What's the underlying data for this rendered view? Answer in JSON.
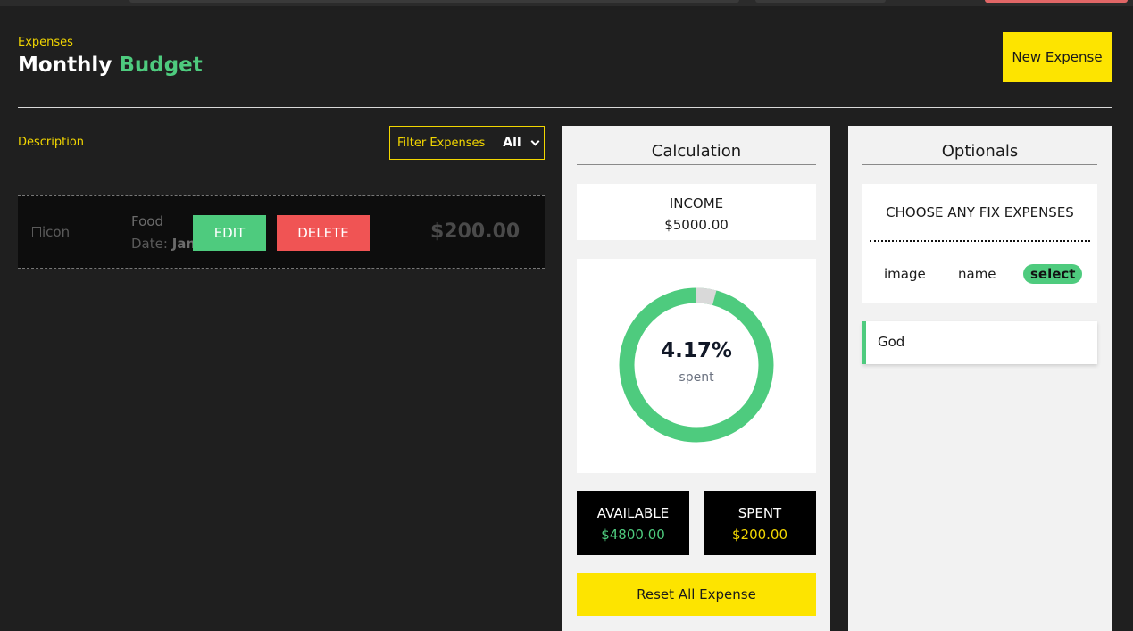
{
  "header": {
    "eyebrow": "Expenses",
    "title_main": "Monthly",
    "title_accent": "Budget",
    "new_expense_label": "New Expense"
  },
  "list": {
    "description_label": "Description",
    "filter_label": "Filter Expenses",
    "filter_value": "All",
    "items": [
      {
        "image_alt": "icon",
        "name": "Food",
        "date_prefix": "Date:",
        "date_value": "Jan 29",
        "edit_label": "EDIT",
        "delete_label": "DELETE",
        "amount": "$200.00"
      }
    ]
  },
  "calculation": {
    "title": "Calculation",
    "income_label": "INCOME",
    "income_value": "$5000.00",
    "spent_percent": "4.17%",
    "spent_fraction": 0.0417,
    "spent_sub": "spent",
    "available_label": "AVAILABLE",
    "available_value": "$4800.00",
    "spent_label": "SPENT",
    "spent_value": "$200.00",
    "reset_label": "Reset All Expense"
  },
  "optionals": {
    "title": "Optionals",
    "choose_title": "CHOOSE ANY FIX EXPENSES",
    "col_image": "image",
    "col_name": "name",
    "col_select": "select",
    "items": [
      {
        "name": "God"
      }
    ]
  },
  "colors": {
    "background": "#1f1f1f",
    "accent_green": "#4ecb7e",
    "accent_yellow": "#fde400",
    "danger_red": "#f05454",
    "donut_remainder": "#d9d9d9"
  }
}
